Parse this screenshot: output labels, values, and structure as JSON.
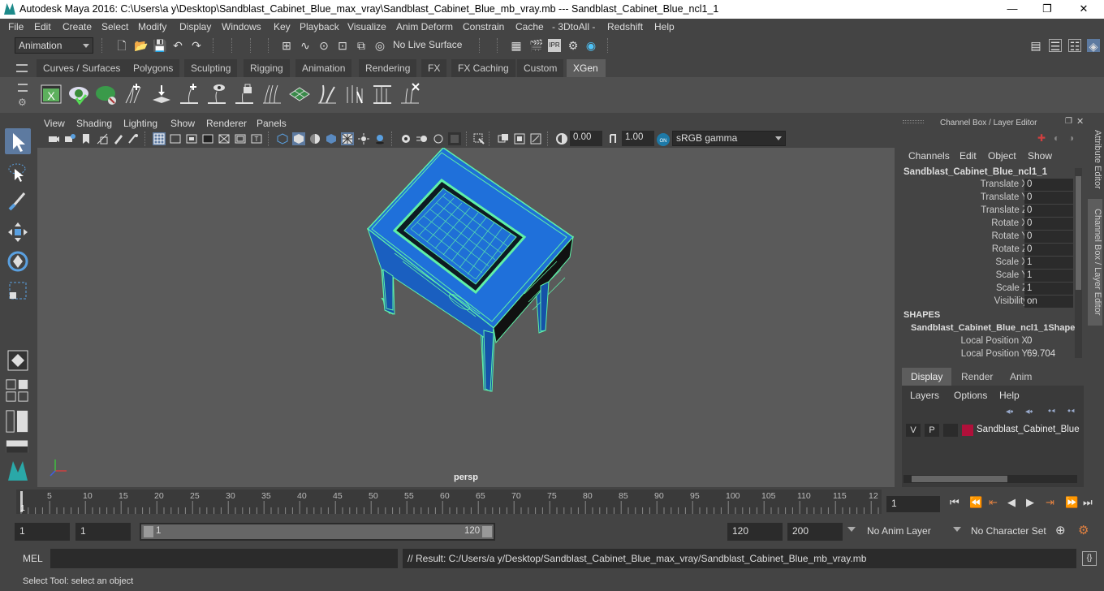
{
  "window": {
    "title": "Autodesk Maya 2016: C:\\Users\\a y\\Desktop\\Sandblast_Cabinet_Blue_max_vray\\Sandblast_Cabinet_Blue_mb_vray.mb    ---    Sandblast_Cabinet_Blue_ncl1_1",
    "minimize": "—",
    "maximize": "❐",
    "close": "✕"
  },
  "menubar": [
    "File",
    "Edit",
    "Create",
    "Select",
    "Modify",
    "Display",
    "Windows",
    "Key",
    "Playback",
    "Visualize",
    "Anim Deform",
    "Constrain",
    "Cache",
    "- 3DtoAll -",
    "Redshift",
    "Help"
  ],
  "statusline": {
    "mode": "Animation",
    "live_surface": "No Live Surface"
  },
  "shelf_tabs": [
    "Curves / Surfaces",
    "Polygons",
    "Sculpting",
    "Rigging",
    "Animation",
    "Rendering",
    "FX",
    "FX Caching",
    "Custom",
    "XGen"
  ],
  "active_shelf_tab": "XGen",
  "panel_menu": [
    "View",
    "Shading",
    "Lighting",
    "Show",
    "Renderer",
    "Panels"
  ],
  "panel_toolbar": {
    "exposure": "0.00",
    "gamma": "1.00",
    "colorspace": "sRGB gamma"
  },
  "viewport": {
    "camera_label": "persp",
    "background": "#5a5a5a",
    "wire_color": "#5ff0a8",
    "mesh_color": "#1d6fd6"
  },
  "channel_box": {
    "header": "Channel Box / Layer Editor",
    "menu": [
      "Channels",
      "Edit",
      "Object",
      "Show"
    ],
    "object_name": "Sandblast_Cabinet_Blue_ncl1_1",
    "attributes": [
      {
        "label": "Translate X",
        "value": "0"
      },
      {
        "label": "Translate Y",
        "value": "0"
      },
      {
        "label": "Translate Z",
        "value": "0"
      },
      {
        "label": "Rotate X",
        "value": "0"
      },
      {
        "label": "Rotate Y",
        "value": "0"
      },
      {
        "label": "Rotate Z",
        "value": "0"
      },
      {
        "label": "Scale X",
        "value": "1"
      },
      {
        "label": "Scale Y",
        "value": "1"
      },
      {
        "label": "Scale Z",
        "value": "1"
      },
      {
        "label": "Visibility",
        "value": "on"
      }
    ],
    "shapes_header": "SHAPES",
    "shape_name": "Sandblast_Cabinet_Blue_ncl1_1Shape",
    "shape_attributes": [
      {
        "label": "Local Position X",
        "value": "0"
      },
      {
        "label": "Local Position Y",
        "value": "69.704"
      }
    ]
  },
  "layer_editor": {
    "tabs": [
      "Display",
      "Render",
      "Anim"
    ],
    "active_tab": "Display",
    "menu": [
      "Layers",
      "Options",
      "Help"
    ],
    "layer": {
      "v": "V",
      "p": "P",
      "color": "#b0103a",
      "name": "Sandblast_Cabinet_Blue"
    }
  },
  "side_tabs": [
    "Attribute Editor",
    "Channel Box / Layer Editor"
  ],
  "timeline": {
    "ticks": [
      "5",
      "10",
      "15",
      "20",
      "25",
      "30",
      "35",
      "40",
      "45",
      "50",
      "55",
      "60",
      "65",
      "70",
      "75",
      "80",
      "85",
      "90",
      "95",
      "100",
      "105",
      "110",
      "115",
      "12"
    ],
    "current_frame": "1",
    "frame_field": "1"
  },
  "range": {
    "start": "1",
    "playback_start": "1",
    "slider_start": "1",
    "slider_end": "120",
    "playback_end": "120",
    "end": "200",
    "anim_layer": "No Anim Layer",
    "character_set": "No Character Set"
  },
  "mel": {
    "label": "MEL",
    "result": "// Result: C:/Users/a y/Desktop/Sandblast_Cabinet_Blue_max_vray/Sandblast_Cabinet_Blue_mb_vray.mb"
  },
  "help_line": "Select Tool: select an object"
}
